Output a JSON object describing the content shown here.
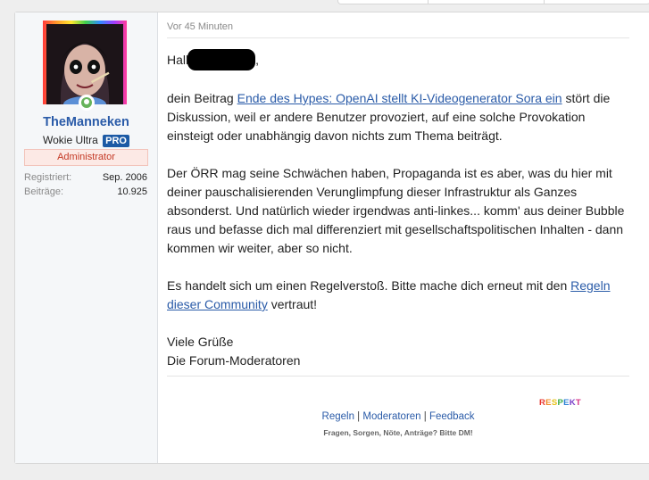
{
  "user": {
    "name": "TheManneken",
    "title": "Wokie Ultra",
    "pro_badge": "PRO",
    "role_banner": "Administrator",
    "stats": [
      {
        "label": "Registriert:",
        "value": "Sep. 2006"
      },
      {
        "label": "Beiträge:",
        "value": "10.925"
      }
    ],
    "online_status": "online"
  },
  "post": {
    "time": "Vor 45 Minuten",
    "greeting_start": "Hall",
    "greeting_end": ",",
    "p1_before": "dein Beitrag ",
    "p1_link": "Ende des Hypes: OpenAI stellt KI-Videogenerator Sora ein",
    "p1_after": " stört die Diskussion, weil er andere Benutzer provoziert, auf eine solche Provokation einsteigt oder unabhängig davon nichts zum Thema beiträgt.",
    "p2": "Der ÖRR mag seine Schwächen haben, Propaganda ist es aber, was du hier mit deiner pauschalisierenden Verunglimpfung dieser Infrastruktur als Ganzes absonderst. Und natürlich wieder irgendwas anti-linkes... komm' aus deiner Bubble raus und befasse dich mal differenziert mit gesellschaftspolitischen Inhalten - dann kommen wir weiter, aber so nicht.",
    "p3_before": "Es handelt sich um einen Regelverstoß. Bitte mache dich erneut mit den ",
    "p3_link": "Regeln dieser Community",
    "p3_after": " vertraut!",
    "closing_1": "Viele Grüße",
    "closing_2": "Die Forum-Moderatoren"
  },
  "signature": {
    "respekt_letters": [
      "R",
      "E",
      "S",
      "P",
      "E",
      "K",
      "T"
    ],
    "respekt_colors": [
      "#e8342e",
      "#f08a24",
      "#e6c21a",
      "#3aa845",
      "#2a7fd4",
      "#7a3fc8",
      "#d63384"
    ],
    "links": [
      "Regeln",
      "Moderatoren",
      "Feedback"
    ],
    "separator": " | ",
    "tagline": "Fragen, Sorgen, Nöte, Anträge? Bitte DM!"
  },
  "colors": {
    "link": "#2a5ba8",
    "username": "#2a5ba8",
    "admin_text": "#c43a26",
    "pro_badge_bg": "#1c5aa5",
    "online_dot": "#67b35b"
  }
}
